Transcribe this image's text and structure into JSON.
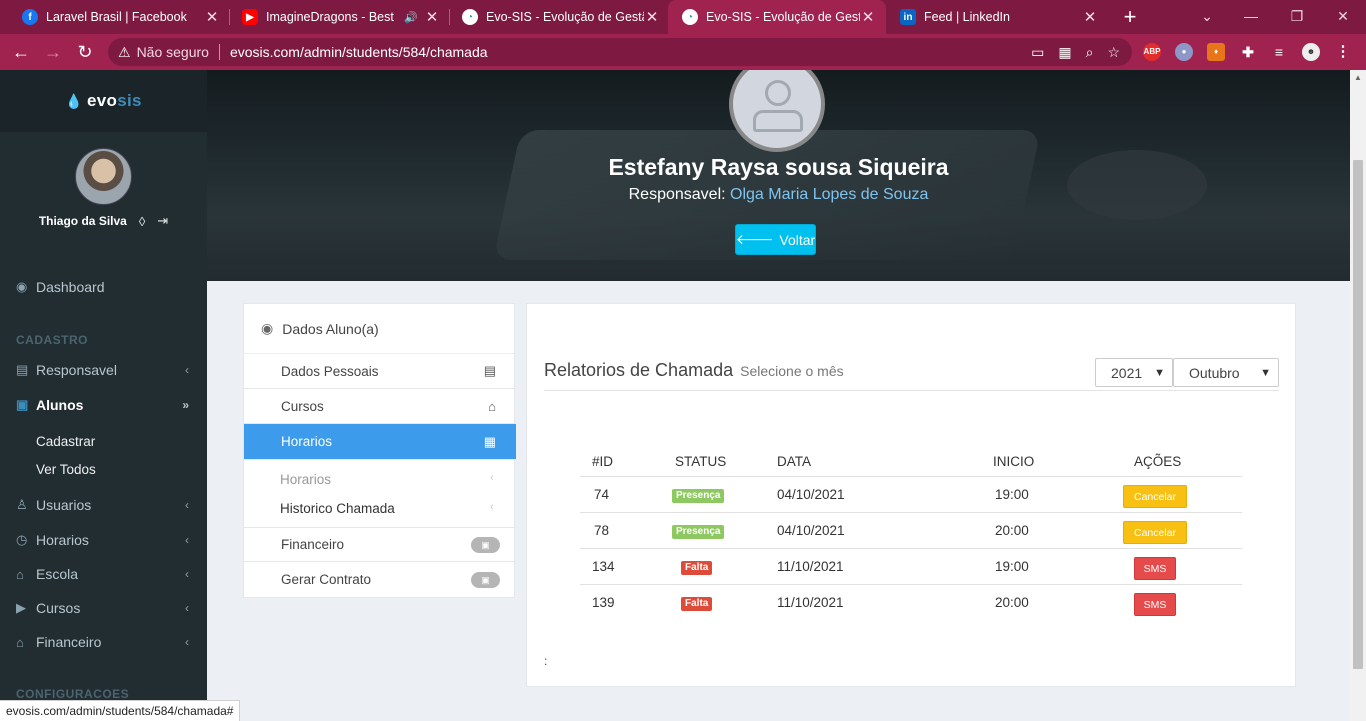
{
  "browser": {
    "tabs": [
      {
        "title": "Laravel Brasil | Facebook",
        "icon": "facebook-icon",
        "color": "#1877f2"
      },
      {
        "title": "ImagineDragons - Best S",
        "icon": "youtube-icon",
        "color": "#ff0000"
      },
      {
        "title": "Evo-SIS - Evolução de Gestão",
        "icon": "evosis-icon",
        "color": "#3c8dbc"
      },
      {
        "title": "Evo-SIS - Evolução de Gestão",
        "icon": "evosis-icon",
        "color": "#3c8dbc"
      },
      {
        "title": "Feed | LinkedIn",
        "icon": "linkedin-icon",
        "color": "#0a66c2"
      }
    ],
    "address": {
      "security_label": "Não seguro",
      "url": "evosis.com/admin/students/584/chamada"
    },
    "status_url": "evosis.com/admin/students/584/chamada#",
    "ext_abp": "ABP"
  },
  "sidebar": {
    "logo_a": "evo",
    "logo_b": "sis",
    "user_name": "Thiago da Silva",
    "dashboard": "Dashboard",
    "header_cadastro": "CADASTRO",
    "responsavel": "Responsavel",
    "alunos": "Alunos",
    "cadastrar": "Cadastrar",
    "ver_todos": "Ver Todos",
    "usuarios": "Usuarios",
    "horarios": "Horarios",
    "escola": "Escola",
    "cursos": "Cursos",
    "financeiro": "Financeiro",
    "header_config": "CONFIGURACOES"
  },
  "hero": {
    "student_name": "Estefany Raysa sousa Siqueira",
    "resp_label": "Responsavel:",
    "resp_name": "Olga Maria Lopes de Souza",
    "back_label": "Voltar"
  },
  "left_panel": {
    "title": "Dados Aluno(a)",
    "dados_pessoais": "Dados Pessoais",
    "cursos": "Cursos",
    "horarios": "Horarios",
    "sub_horarios": "Horarios",
    "sub_historico": "Historico Chamada",
    "financeiro": "Financeiro",
    "gerar_contrato": "Gerar Contrato"
  },
  "report": {
    "title": "Relatorios de Chamada",
    "subtitle": "Selecione o mês",
    "year": "2021",
    "month": "Outubro",
    "footer_mark": ":",
    "headers": {
      "id": "#ID",
      "status": "STATUS",
      "data": "DATA",
      "inicio": "INICIO",
      "acoes": "AÇÕES"
    },
    "rows": [
      {
        "id": "74",
        "status": "Presença",
        "data": "04/10/2021",
        "inicio": "19:00",
        "acao": "Cancelar"
      },
      {
        "id": "78",
        "status": "Presença",
        "data": "04/10/2021",
        "inicio": "20:00",
        "acao": "Cancelar"
      },
      {
        "id": "134",
        "status": "Falta",
        "data": "11/10/2021",
        "inicio": "19:00",
        "acao": "SMS"
      },
      {
        "id": "139",
        "status": "Falta",
        "data": "11/10/2021",
        "inicio": "20:00",
        "acao": "SMS"
      }
    ]
  }
}
